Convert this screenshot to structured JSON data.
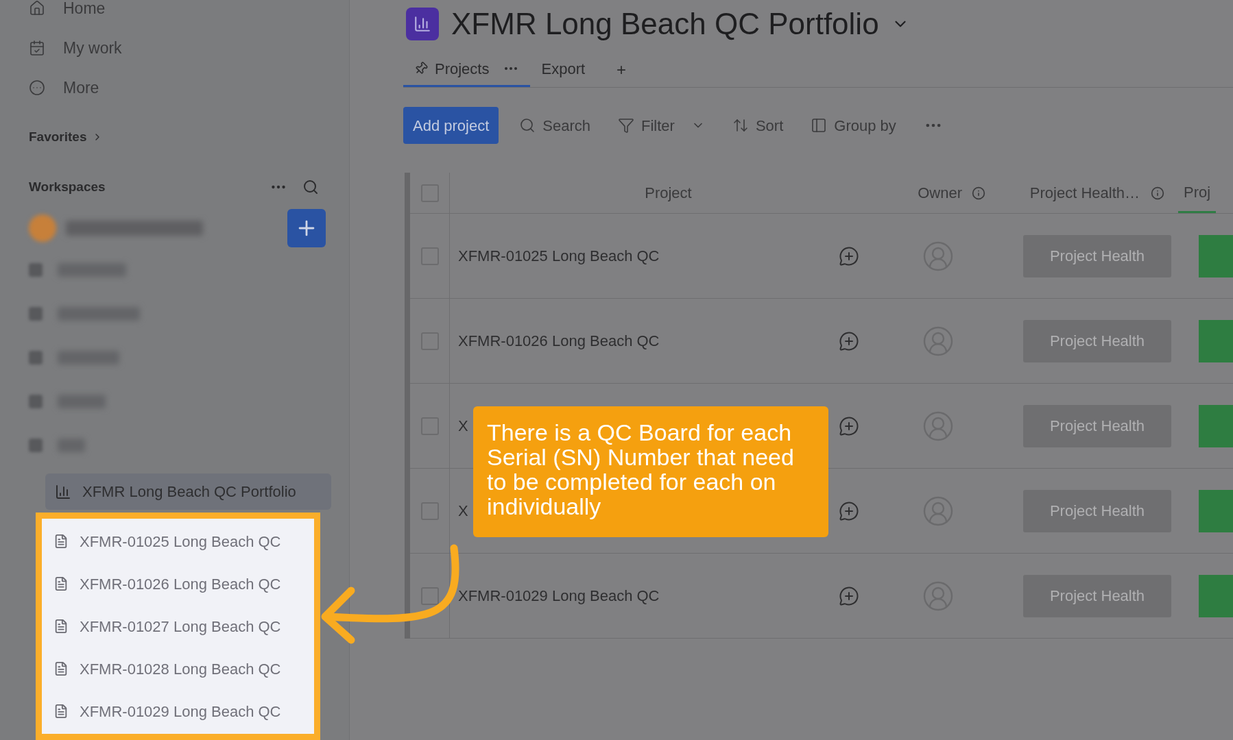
{
  "sidebar": {
    "nav": [
      {
        "label": "Home",
        "kind": "home"
      },
      {
        "label": "My work",
        "kind": "calendar"
      },
      {
        "label": "More",
        "kind": "more"
      }
    ],
    "favorites": "Favorites",
    "workspaces": "Workspaces",
    "portfolio": {
      "label": "XFMR Long Beach QC Portfolio",
      "selected": true
    },
    "qc_boards_highlighted": true,
    "qc_boards": [
      {
        "label": "XFMR-01025 Long Beach QC"
      },
      {
        "label": "XFMR-01026 Long Beach QC"
      },
      {
        "label": "XFMR-01027 Long Beach QC"
      },
      {
        "label": "XFMR-01028 Long Beach QC"
      },
      {
        "label": "XFMR-01029 Long Beach QC"
      }
    ]
  },
  "title": "XFMR Long Beach QC Portfolio",
  "tabs": [
    {
      "label": "Projects",
      "selected": true
    },
    {
      "label": "Export",
      "selected": false
    }
  ],
  "add_tab": "+",
  "toolbar": {
    "primary": "Add project",
    "items": [
      {
        "label": "Search",
        "kind": "search"
      },
      {
        "label": "Filter",
        "kind": "filter"
      },
      {
        "label": "Sort",
        "kind": "sort"
      },
      {
        "label": "Group by",
        "kind": "group"
      }
    ]
  },
  "table": {
    "all_checked": false,
    "columns": [
      "Project",
      "Owner",
      "Project Health…",
      "Proj"
    ],
    "rows": [
      {
        "name": "XFMR-01025 Long Beach QC",
        "checked": false,
        "health": "Project Health"
      },
      {
        "name": "XFMR-01026 Long Beach QC",
        "checked": false,
        "health": "Project Health"
      },
      {
        "name": "X",
        "checked": false,
        "health": "Project Health"
      },
      {
        "name": "X",
        "checked": false,
        "health": "Project Health"
      },
      {
        "name": "XFMR-01029 Long Beach QC",
        "checked": false,
        "health": "Project Health"
      }
    ]
  },
  "callout": "There is a QC Board for each Serial (SN) Number that need to be completed for each on individually"
}
